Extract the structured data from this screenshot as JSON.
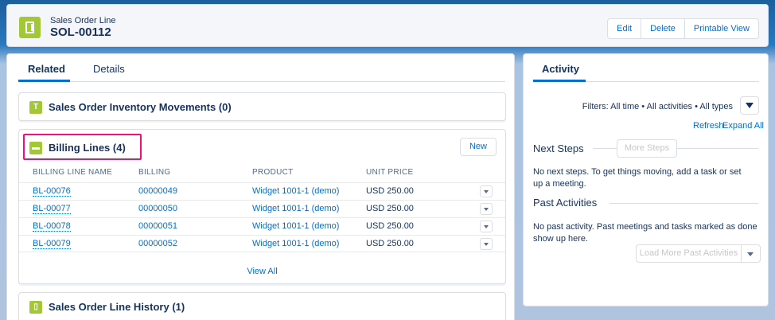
{
  "header": {
    "object_type": "Sales Order Line",
    "record_name": "SOL-00112",
    "buttons": [
      "Edit",
      "Delete",
      "Printable View"
    ]
  },
  "tabs": [
    "Related",
    "Details"
  ],
  "related": {
    "inventory_card": {
      "title": "Sales Order Inventory Movements (0)",
      "icon_letter": "T"
    },
    "billing_card": {
      "title": "Billing Lines (4)",
      "new_label": "New",
      "columns": [
        "BILLING LINE NAME",
        "BILLING",
        "PRODUCT",
        "UNIT PRICE"
      ],
      "rows": [
        {
          "name": "BL-00076",
          "billing": "00000049",
          "product": "Widget 1001-1 (demo)",
          "price": "USD 250.00"
        },
        {
          "name": "BL-00077",
          "billing": "00000050",
          "product": "Widget 1001-1 (demo)",
          "price": "USD 250.00"
        },
        {
          "name": "BL-00078",
          "billing": "00000051",
          "product": "Widget 1001-1 (demo)",
          "price": "USD 250.00"
        },
        {
          "name": "BL-00079",
          "billing": "00000052",
          "product": "Widget 1001-1 (demo)",
          "price": "USD 250.00"
        }
      ],
      "view_all": "View All"
    },
    "history_card": {
      "title": "Sales Order Line History (1)"
    }
  },
  "activity": {
    "tab": "Activity",
    "filters": "Filters: All time • All activities • All types",
    "refresh": "Refresh",
    "expand_all": "Expand All",
    "next_steps": {
      "title": "Next Steps",
      "button": "More Steps",
      "empty": "No next steps. To get things moving, add a task or set up a meeting."
    },
    "past": {
      "title": "Past Activities",
      "empty": "No past activity. Past meetings and tasks marked as done show up here.",
      "button": "Load More Past Activities"
    }
  },
  "colors": {
    "accent": "#0070d2",
    "icon_green": "#a3c837",
    "highlight": "#e4157c"
  }
}
